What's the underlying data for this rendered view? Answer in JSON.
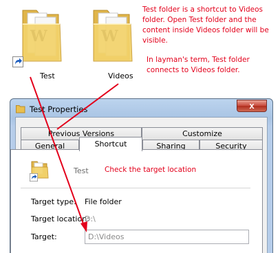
{
  "desktop": {
    "icons": [
      {
        "label": "Test"
      },
      {
        "label": "Videos"
      }
    ]
  },
  "annotations": {
    "note1": "Test folder is a shortcut to Videos folder. Open Test folder and the content inside Videos folder will be visible.",
    "note2": "In layman's term, Test folder connects to Videos folder.",
    "note3": "Check the target location"
  },
  "dialog": {
    "title": "Test Properties",
    "close_symbol": "x",
    "tabs_row1": [
      "Previous Versions",
      "Customize"
    ],
    "tabs_row2": [
      "General",
      "Shortcut",
      "Sharing",
      "Security"
    ],
    "active_tab": "Shortcut",
    "shortcut": {
      "name": "Test",
      "target_type_label": "Target type:",
      "target_type_value": "File folder",
      "target_location_label": "Target location:",
      "target_location_value": "D:\\",
      "target_label": "Target:",
      "target_value": "D:\\Videos"
    }
  },
  "colors": {
    "annotation": "#e3001b",
    "arrow": "#e3001b",
    "folder_yellow": "#f3d36b"
  },
  "icons": [
    "folder-icon",
    "shortcut-arrow-icon",
    "close-icon"
  ]
}
